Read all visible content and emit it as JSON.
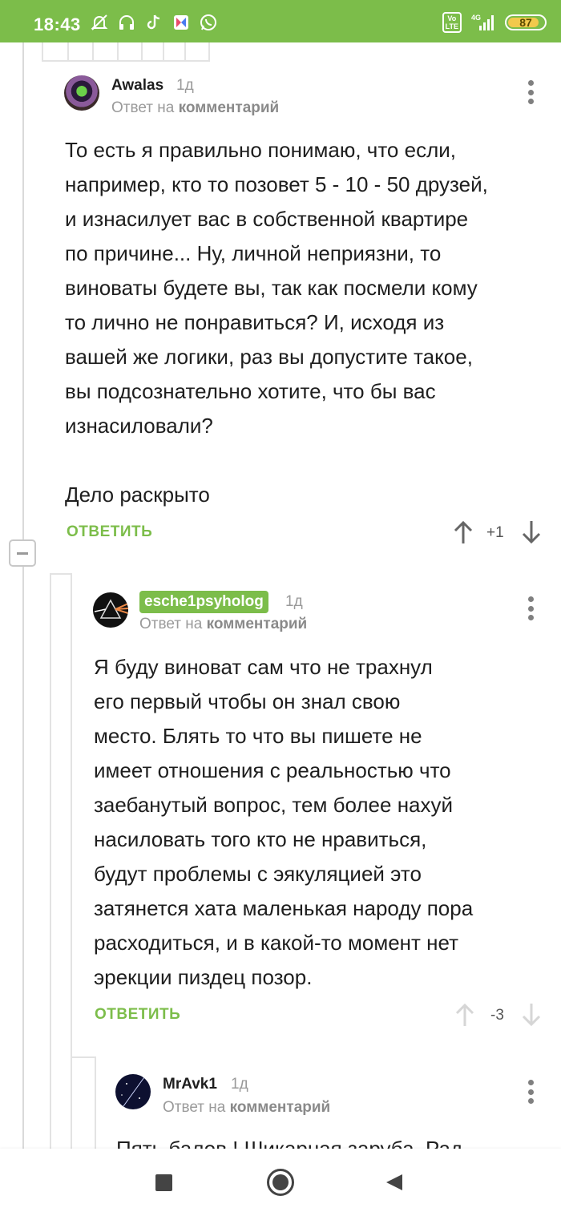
{
  "status": {
    "time": "18:43",
    "network": "4G",
    "volte": "Vo\nLTE",
    "battery": "87"
  },
  "comments": [
    {
      "author": "Awalas",
      "time": "1д",
      "reply_prefix": "Ответ на",
      "reply_target": "комментарий",
      "text": "То есть я правильно понимаю, что если,\nнапример, кто то позовет 5 - 10 - 50 друзей,\nи изнасилует вас в собственной квартире\nпо причине... Ну, личной неприязни, то\nвиноваты будете вы, так как посмели кому\nто лично не понравиться? И, исходя из\nвашей же логики, раз вы допустите такое,\nвы подсознательно хотите, что бы вас\nизнасиловали?\n\nДело раскрыто",
      "reply_label": "ОТВЕТИТЬ",
      "rating": "+1"
    },
    {
      "author": "esche1psyholog",
      "time": "1д",
      "reply_prefix": "Ответ на",
      "reply_target": "комментарий",
      "text": "Я буду виноват сам что не трахнул\nего первый чтобы он знал свою\nместо. Блять то что вы пишете не\nимеет отношения с реальностью что\nзаебанутый вопрос, тем более нахуй\nнасиловать того кто не нравиться,\nбудут проблемы с эякуляцией это\nзатянется хата маленькая народу пора\nрасходиться, и в какой-то момент нет\nэрекции пиздец позор.",
      "reply_label": "ОТВЕТИТЬ",
      "rating": "-3"
    },
    {
      "author": "MrAvk1",
      "time": "1д",
      "reply_prefix": "Ответ на",
      "reply_target": "комментарий",
      "text": "Пять балов ! Шикарная заруба. Рад"
    }
  ],
  "icons": [
    "dnd-icon",
    "headphones-icon",
    "tiktok-icon",
    "app-icon",
    "whatsapp-icon",
    "signal-icon",
    "battery-icon",
    "more-icon",
    "upvote-icon",
    "downvote-icon",
    "collapse-icon",
    "nav-square-icon",
    "nav-home-icon",
    "nav-back-icon"
  ],
  "colors": {
    "accent": "#7cbd4a",
    "text": "#1e1e1e",
    "muted": "#9a9a9a"
  }
}
